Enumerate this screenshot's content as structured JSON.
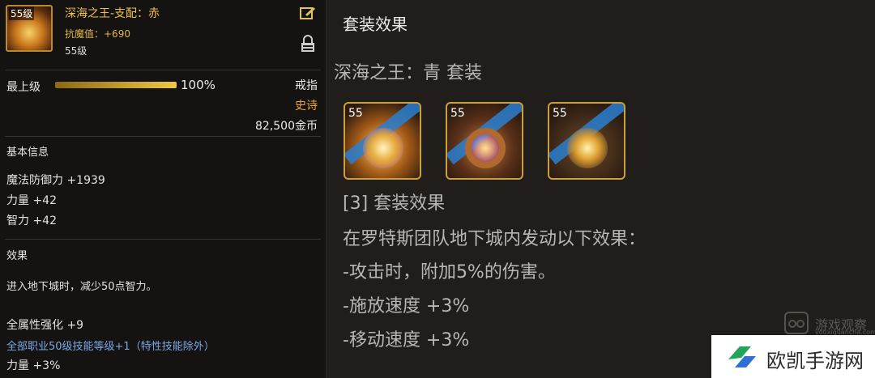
{
  "item": {
    "level_badge": "55级",
    "name": "深海之王-支配：赤",
    "resist": "抗魔值：+690",
    "level": "55级",
    "grade_label": "最上级",
    "grade_percent": "100%",
    "grade_fill": 1.0,
    "type": "戒指",
    "rarity": "史诗",
    "price": "82,500金币"
  },
  "basic": {
    "title": "基本信息",
    "stats": [
      "魔法防御力 +1939",
      "力量 +42",
      "智力 +42"
    ]
  },
  "effect": {
    "title": "效果",
    "desc": "进入地下城时，减少50点智力。",
    "all_attr": "全属性强化 +9",
    "skill_line": "全部职业50级技能等级+1（特性技能除外）",
    "str_pct": "力量 +3%"
  },
  "set": {
    "header": "套装效果",
    "name": "深海之王：青  套装",
    "slot_tags": [
      "55",
      "55",
      "55"
    ],
    "effect_title": "[3] 套装效果",
    "lines": [
      "在罗特斯团队地下城内发动以下效果：",
      "-攻击时，附加5%的伤害。",
      "-施放速度 +3%",
      "-移动速度 +3%"
    ]
  },
  "watermark": {
    "text": "游戏观察",
    "url": "youxiguancha.com"
  },
  "brand": {
    "text": "欧凯手游网"
  },
  "icons": [
    "edit-icon",
    "lock-icon",
    "brand-logo-icon"
  ],
  "colors": {
    "gold": "#f0c24a",
    "epic": "#e7a53a",
    "skill_blue": "#7aa8e6",
    "frame": "#caa03a"
  }
}
